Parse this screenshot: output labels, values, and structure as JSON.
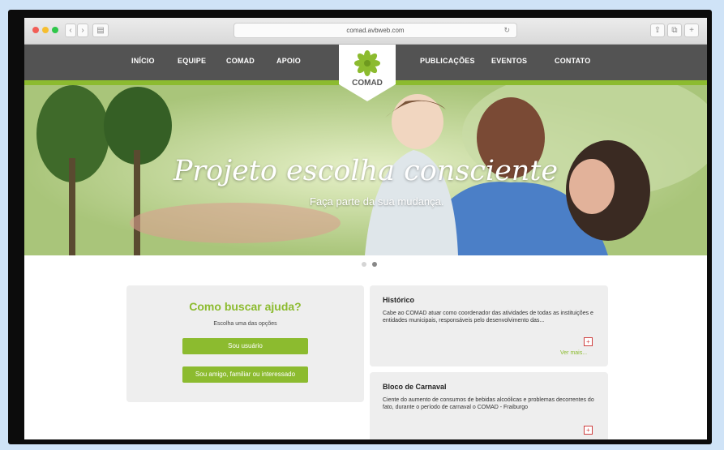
{
  "browser": {
    "url": "comad.avbweb.com"
  },
  "nav": {
    "items_left": [
      "INÍCIO",
      "EQUIPE",
      "COMAD",
      "APOIO"
    ],
    "items_right": [
      "PUBLICAÇÕES",
      "EVENTOS",
      "CONTATO"
    ],
    "logo_text": "COMAD"
  },
  "hero": {
    "title": "Projeto escolha consciente",
    "subtitle": "Faça parte da sua mudança."
  },
  "help": {
    "title": "Como buscar ajuda?",
    "subtitle": "Escolha uma das opções",
    "button_user": "Sou usuário",
    "button_friend": "Sou amigo, familiar ou interessado"
  },
  "news": [
    {
      "title": "Histórico",
      "body": "Cabe ao COMAD atuar como coordenador das atividades de todas as instituições e entidades municipais, responsáveis pelo desenvolvimento das...",
      "more": "Ver mais..."
    },
    {
      "title": "Bloco de Carnaval",
      "body": "Ciente do aumento de consumos de bebidas alcoólicas e problemas decorrentes do fato, durante o período de carnaval o COMAD - Fraiburgo"
    }
  ],
  "colors": {
    "accent": "#8cbb2f",
    "nav": "#535353",
    "card": "#eeeeee"
  }
}
